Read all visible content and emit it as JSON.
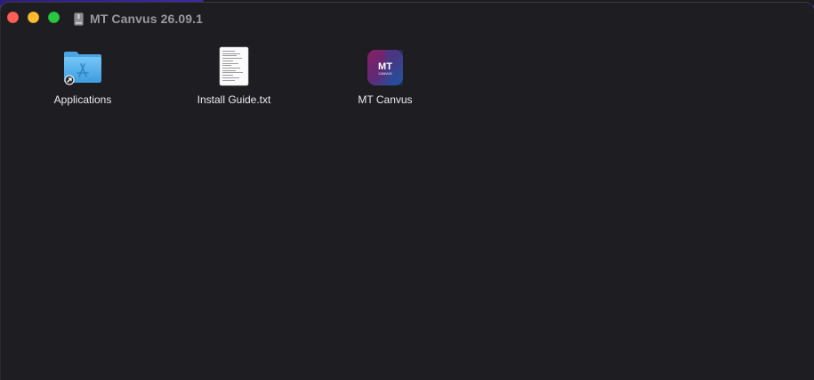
{
  "window": {
    "title": "MT Canvus 26.09.1",
    "title_icon": "disk-image-icon",
    "controls": [
      "close",
      "minimize",
      "zoom"
    ]
  },
  "items": [
    {
      "label": "Applications",
      "icon": "applications-folder-alias-icon"
    },
    {
      "label": "Install Guide.txt",
      "icon": "text-document-icon"
    },
    {
      "label": "MT Canvus",
      "icon": "mt-canvus-app-icon"
    }
  ],
  "app_icon": {
    "text": "MT",
    "subtext": "CANVUS"
  },
  "colors": {
    "window_bg": "#1e1d22",
    "title_text": "#9a999e",
    "label_text": "#ecebee",
    "close": "#ff5f57",
    "minimize": "#febc2e",
    "zoom": "#28c840",
    "folder": "#5ab0ea"
  }
}
